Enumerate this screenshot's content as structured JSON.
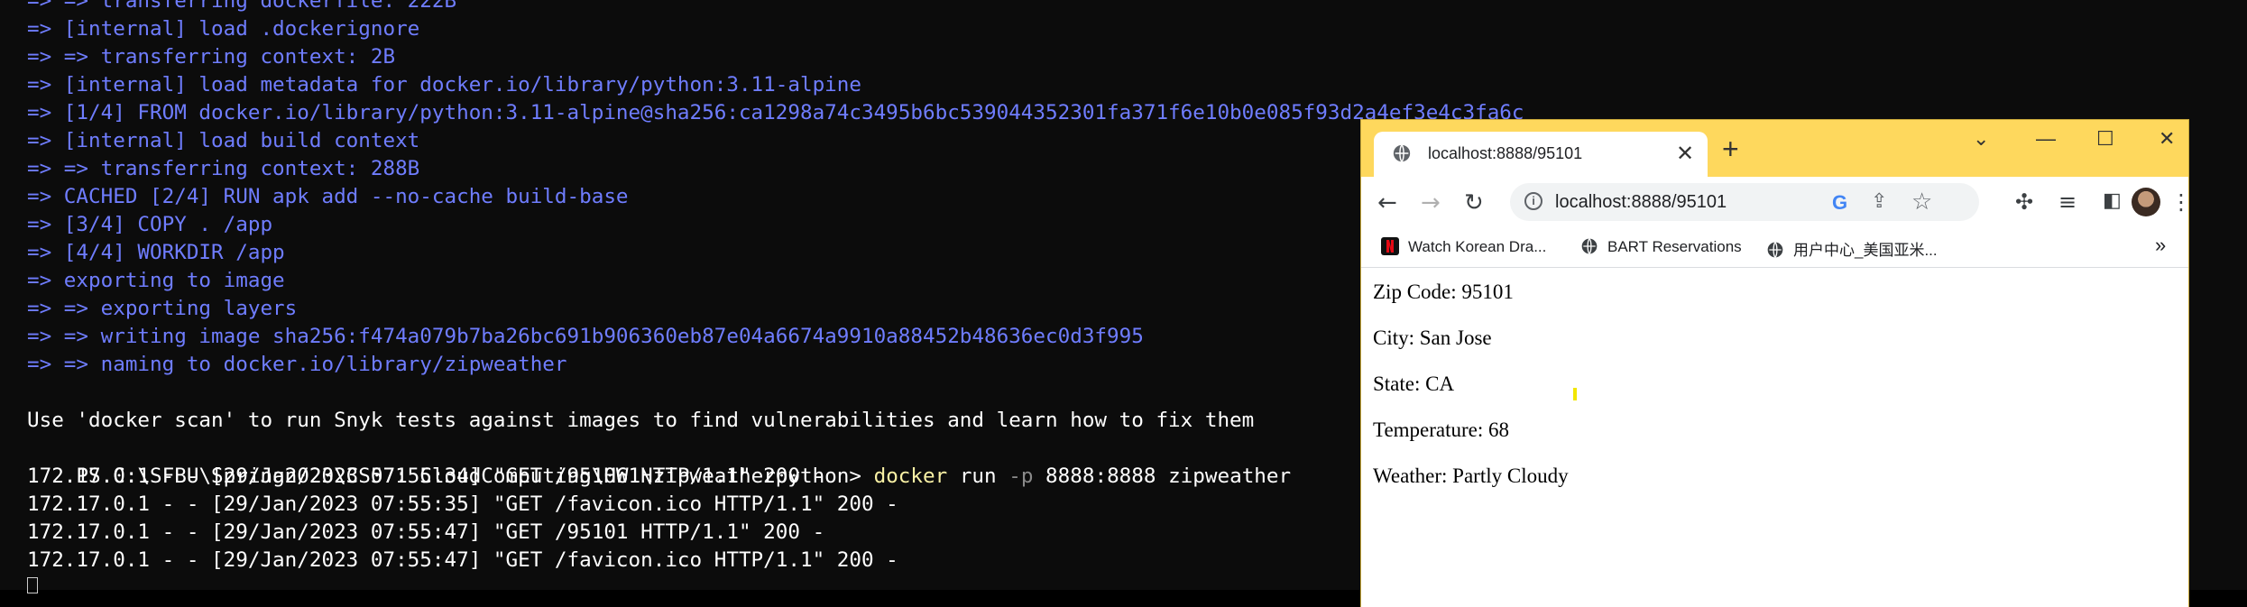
{
  "terminal": {
    "lines": [
      {
        "text": "=> => transferring dockerfile: 222B",
        "color": "blue"
      },
      {
        "text": "=> [internal] load .dockerignore",
        "color": "blue"
      },
      {
        "text": "=> => transferring context: 2B",
        "color": "blue"
      },
      {
        "text": "=> [internal] load metadata for docker.io/library/python:3.11-alpine",
        "color": "blue"
      },
      {
        "text": "=> [1/4] FROM docker.io/library/python:3.11-alpine@sha256:ca1298a74c3495b6bc539044352301fa371f6e10b0e085f93d2a4ef3e4c3fa6c",
        "color": "blue"
      },
      {
        "text": "=> [internal] load build context",
        "color": "blue"
      },
      {
        "text": "=> => transferring context: 288B",
        "color": "blue"
      },
      {
        "text": "=> CACHED [2/4] RUN apk add --no-cache build-base",
        "color": "blue"
      },
      {
        "text": "=> [3/4] COPY . /app",
        "color": "blue"
      },
      {
        "text": "=> [4/4] WORKDIR /app",
        "color": "blue"
      },
      {
        "text": "=> exporting to image",
        "color": "blue"
      },
      {
        "text": "=> => exporting layers",
        "color": "blue"
      },
      {
        "text": "=> => writing image sha256:f474a079b7ba26bc691b906360eb87e04a6674a9910a88452b48636ec0d3f995",
        "color": "blue"
      },
      {
        "text": "=> => naming to docker.io/library/zipweather",
        "color": "blue"
      },
      {
        "text": "",
        "color": "white"
      },
      {
        "text": "Use 'docker scan' to run Snyk tests against images to find vulnerabilities and learn how to fix them",
        "color": "white"
      }
    ],
    "prompt": {
      "path": "PS C:\\SFBU\\Spring2023\\CS571 CloudComputing\\HW1\\zipweatherpython> ",
      "command": "docker",
      "arg1": " run ",
      "flag": "-p",
      "rest": " 8888:8888 zipweather"
    },
    "log_lines": [
      "172.17.0.1 - - [29/Jan/2023 07:55:34] \"GET /95106 HTTP/1.1\" 200 -",
      "172.17.0.1 - - [29/Jan/2023 07:55:35] \"GET /favicon.ico HTTP/1.1\" 200 -",
      "172.17.0.1 - - [29/Jan/2023 07:55:47] \"GET /95101 HTTP/1.1\" 200 -",
      "172.17.0.1 - - [29/Jan/2023 07:55:47] \"GET /favicon.ico HTTP/1.1\" 200 -"
    ]
  },
  "browser": {
    "tab_title": "localhost:8888/95101",
    "url": "localhost:8888/95101",
    "bookmarks": [
      {
        "label": "Watch Korean Dra...",
        "icon": "netflix-icon"
      },
      {
        "label": "BART Reservations",
        "icon": "globe-icon"
      },
      {
        "label": "用户中心_美国亚米...",
        "icon": "globe-icon"
      }
    ],
    "bookmarks_overflow": "»",
    "page": {
      "zip": "Zip Code: 95101",
      "city": "City: San Jose",
      "state": "State: CA",
      "temperature": "Temperature: 68",
      "weather": "Weather: Partly Cloudy"
    }
  },
  "colors": {
    "terminal_bg": "#0c0c0c",
    "terminal_blue": "#6f7dff",
    "terminal_yellow": "#f9f1a5",
    "chrome_titlebar": "#fed85d"
  }
}
